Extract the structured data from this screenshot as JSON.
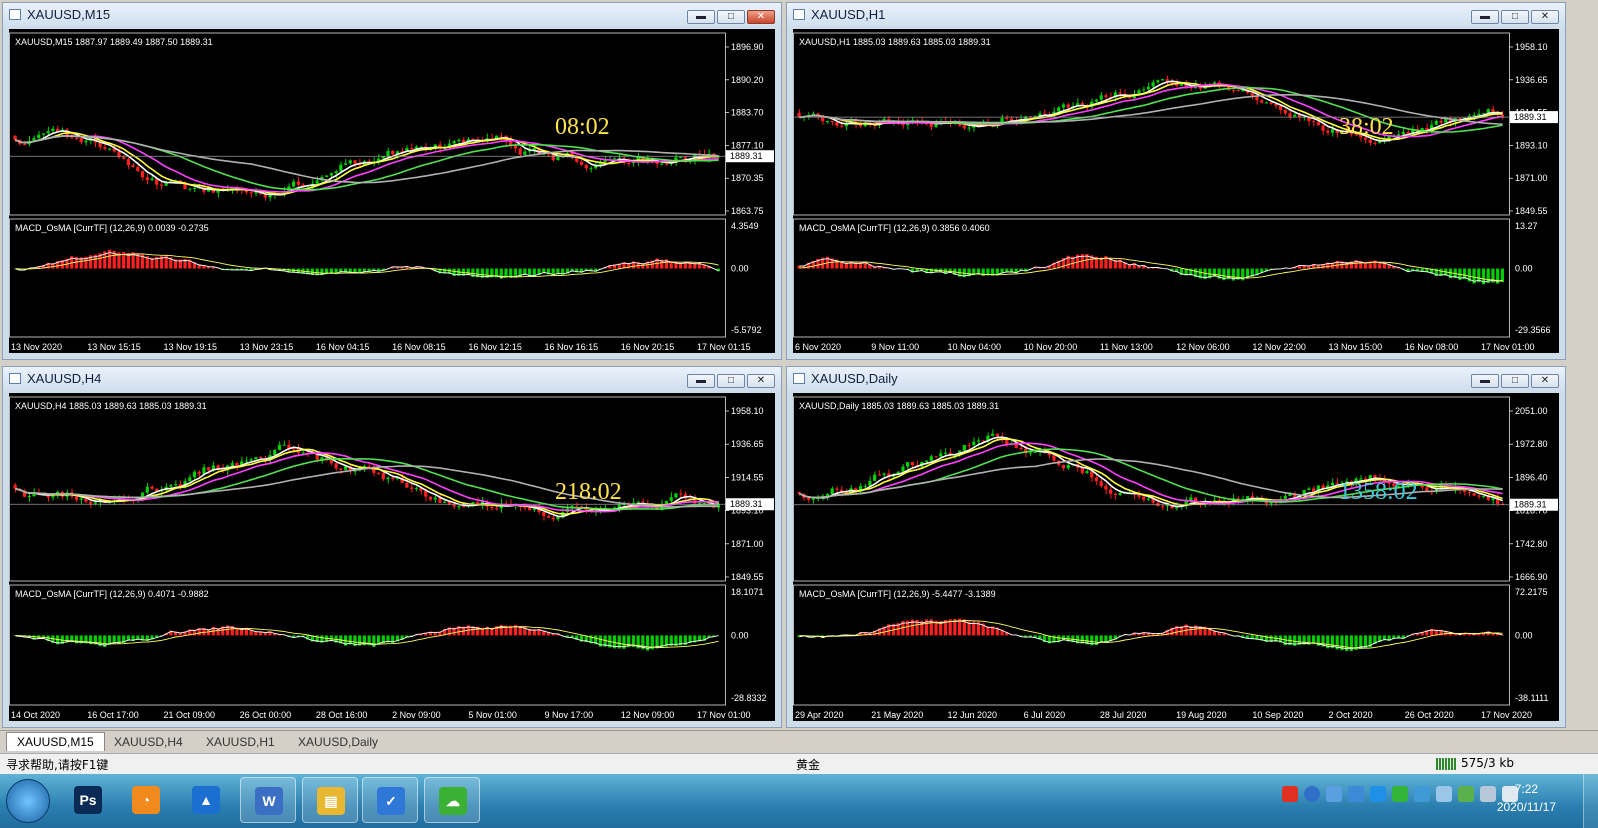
{
  "windows": [
    {
      "title": "XAUUSD,M15",
      "info": "XAUUSD,M15  1887.97 1889.49 1887.50 1889.31",
      "price_ticks": [
        "1896.90",
        "1890.20",
        "1883.70",
        "1877.10",
        "1870.35",
        "1863.75"
      ],
      "current_price": "1889.31",
      "macd_label": "MACD_OsMA [CurrTF] (12,26,9) 0.0039 -0.2735",
      "macd_ticks": [
        "4.3549",
        "0.00",
        "-5.5792"
      ],
      "time_labels": [
        "13 Nov 2020",
        "13 Nov 15:15",
        "13 Nov 19:15",
        "13 Nov 23:15",
        "16 Nov 04:15",
        "16 Nov 08:15",
        "16 Nov 12:15",
        "16 Nov 16:15",
        "16 Nov 20:15",
        "17 Nov 01:15"
      ],
      "timer": "08:02",
      "timer_color": "#ffe34a"
    },
    {
      "title": "XAUUSD,H1",
      "info": "XAUUSD,H1  1885.03 1889.63 1885.03 1889.31",
      "price_ticks": [
        "1958.10",
        "1936.65",
        "1914.55",
        "1893.10",
        "1871.00",
        "1849.55"
      ],
      "current_price": "1889.31",
      "macd_label": "MACD_OsMA [CurrTF] (12,26,9) 0.3856 0.4060",
      "macd_ticks": [
        "13.27",
        "0.00",
        "-29.3566"
      ],
      "time_labels": [
        "6 Nov 2020",
        "9 Nov 11:00",
        "10 Nov 04:00",
        "10 Nov 20:00",
        "11 Nov 13:00",
        "12 Nov 06:00",
        "12 Nov 22:00",
        "13 Nov 15:00",
        "16 Nov 08:00",
        "17 Nov 01:00"
      ],
      "timer": "38:02",
      "timer_color": "#ffe34a"
    },
    {
      "title": "XAUUSD,H4",
      "info": "XAUUSD,H4  1885.03 1889.63 1885.03 1889.31",
      "price_ticks": [
        "1958.10",
        "1936.65",
        "1914.55",
        "1893.10",
        "1871.00",
        "1849.55"
      ],
      "current_price": "1889.31",
      "macd_label": "MACD_OsMA [CurrTF] (12,26,9) 0.4071 -0.9882",
      "macd_ticks": [
        "18.1071",
        "0.00",
        "-28.8332"
      ],
      "time_labels": [
        "14 Oct 2020",
        "16 Oct 17:00",
        "21 Oct 09:00",
        "26 Oct 00:00",
        "28 Oct 16:00",
        "2 Nov 09:00",
        "5 Nov 01:00",
        "9 Nov 17:00",
        "12 Nov 09:00",
        "17 Nov 01:00"
      ],
      "timer": "218:02",
      "timer_color": "#ffe34a"
    },
    {
      "title": "XAUUSD,Daily",
      "info": "XAUUSD,Daily  1885.03 1889.63 1885.03 1889.31",
      "price_ticks": [
        "2051.00",
        "1972.80",
        "1896.40",
        "1818.70",
        "1742.80",
        "1666.90"
      ],
      "current_price": "1889.31",
      "macd_label": "MACD_OsMA [CurrTF] (12,26,9) -5.4477 -3.1389",
      "macd_ticks": [
        "72.2175",
        "0.00",
        "-38.1111"
      ],
      "time_labels": [
        "29 Apr 2020",
        "21 May 2020",
        "12 Jun 2020",
        "6 Jul 2020",
        "28 Jul 2020",
        "19 Aug 2020",
        "10 Sep 2020",
        "2 Oct 2020",
        "26 Oct 2020",
        "17 Nov 2020"
      ],
      "timer": "1358:02",
      "timer_color": "#3fc8d8"
    }
  ],
  "window_buttons": {
    "minimize": "▬",
    "maximize": "□",
    "close": "✕"
  },
  "tabs": [
    "XAUUSD,M15",
    "XAUUSD,H4",
    "XAUUSD,H1",
    "XAUUSD,Daily"
  ],
  "status": {
    "help": "寻求帮助,请按F1键",
    "profile": "黄金",
    "traffic": "575/3 kb"
  },
  "taskbar": {
    "apps": [
      {
        "icon": "photoshop-icon",
        "glyph": "Ps",
        "color": "#0a2a55"
      },
      {
        "icon": "browser-icon",
        "glyph": "◔",
        "color": "#f08a1c"
      },
      {
        "icon": "mt4-icon",
        "glyph": "▲",
        "color": "#1b6fd0"
      },
      {
        "icon": "document-icon",
        "glyph": "W",
        "color": "#3b6fc4"
      },
      {
        "icon": "folder-icon",
        "glyph": "▤",
        "color": "#e8b830"
      },
      {
        "icon": "chat-icon",
        "glyph": "✓",
        "color": "#2f78d8"
      },
      {
        "icon": "wechat-icon",
        "glyph": "☁",
        "color": "#3cb034"
      }
    ],
    "time": "7:22",
    "date": "2020/11/17"
  }
}
